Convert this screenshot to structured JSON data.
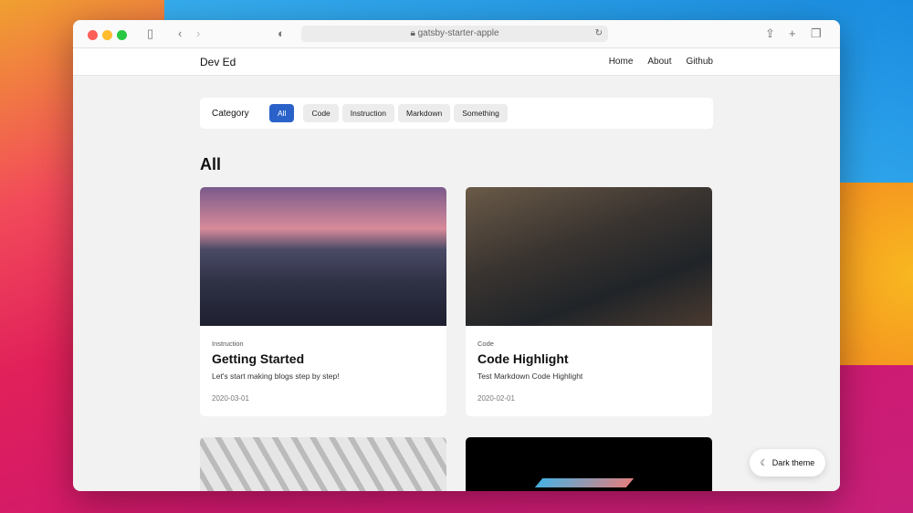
{
  "browser": {
    "url": "gatsby-starter-apple"
  },
  "nav": {
    "brand": "Dev Ed",
    "links": [
      "Home",
      "About",
      "Github"
    ]
  },
  "category": {
    "label": "Category",
    "chips": [
      "All",
      "Code",
      "Instruction",
      "Markdown",
      "Something"
    ]
  },
  "heading": "All",
  "posts": [
    {
      "category": "Instruction",
      "title": "Getting Started",
      "description": "Let's start making blogs step by step!",
      "date": "2020-03-01"
    },
    {
      "category": "Code",
      "title": "Code Highlight",
      "description": "Test Markdown Code Highlight",
      "date": "2020-02-01"
    }
  ],
  "theme_button": "Dark theme",
  "colors": {
    "accent": "#2a62c9"
  }
}
